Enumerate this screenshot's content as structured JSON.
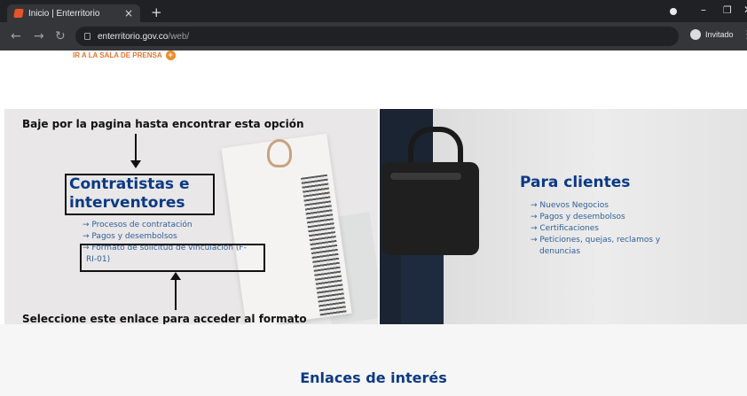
{
  "browser": {
    "tab_title": "Inicio | Enterritorio",
    "tab_close": "×",
    "new_tab": "+",
    "url_host": "enterritorio.gov.co",
    "url_path": "/web/",
    "profile_label": "Invitado"
  },
  "header": {
    "press_link": "IR A LA SALA DE PRENSA",
    "press_plus": "+"
  },
  "left_panel": {
    "annotation_top": "Baje por la pagina hasta encontrar esta opción",
    "title_line1": "Contratistas e",
    "title_line2": "interventores",
    "links": [
      "→ Procesos de contratación",
      "→ Pagos y desembolsos",
      "→ Formato de solicitud de vinculación (F-",
      "RI-01)"
    ],
    "annotation_bottom": "Seleccione este enlace para acceder al formato"
  },
  "right_panel": {
    "title": "Para clientes",
    "links": [
      "→ Nuevos Negocios",
      "→ Pagos y desembolsos",
      "→ Certificaciones",
      "→ Peticiones, quejas, reclamos y",
      "denuncias"
    ]
  },
  "footer": {
    "heading": "Enlaces de interés"
  },
  "colors": {
    "brand_blue": "#0b3a83",
    "link_blue": "#2f5f96",
    "accent_orange": "#e8742d"
  }
}
